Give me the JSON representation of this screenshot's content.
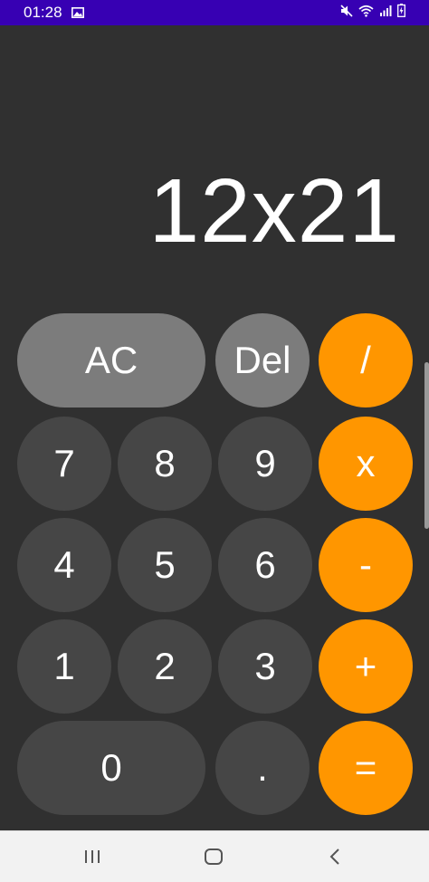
{
  "status_bar": {
    "time": "01:28",
    "background_color": "#3700b3",
    "icons_left": [
      "gallery-icon"
    ],
    "icons_right": [
      "mute-icon",
      "wifi-icon",
      "signal-icon",
      "battery-icon"
    ]
  },
  "display": {
    "expression": "12x21"
  },
  "keys": {
    "ac": "AC",
    "del": "Del",
    "divide": "/",
    "seven": "7",
    "eight": "8",
    "nine": "9",
    "multiply": "x",
    "four": "4",
    "five": "5",
    "six": "6",
    "minus": "-",
    "one": "1",
    "two": "2",
    "three": "3",
    "plus": "+",
    "zero": "0",
    "dot": ".",
    "equals": "="
  },
  "colors": {
    "background": "#303030",
    "function_key": "#7c7c7c",
    "number_key": "#464646",
    "operator_key": "#ff9600"
  },
  "nav_bar": {
    "icons": [
      "recent-apps-icon",
      "home-icon",
      "back-icon"
    ]
  }
}
